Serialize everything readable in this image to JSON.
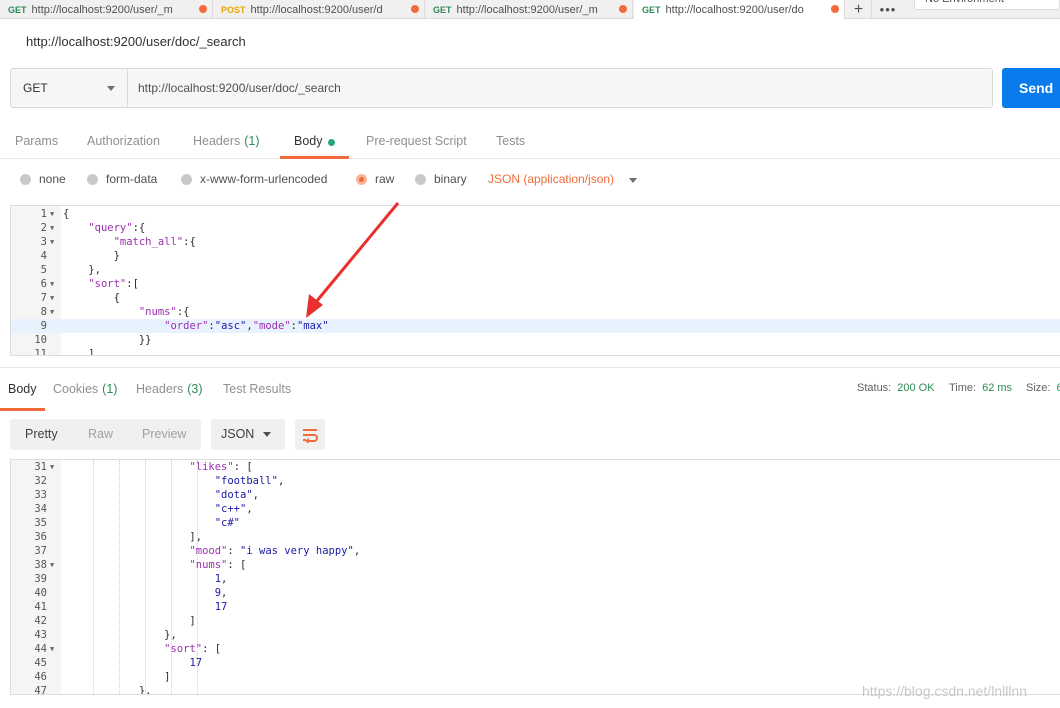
{
  "tabs": [
    {
      "method": "GET",
      "url": "http://localhost:9200/user/_m"
    },
    {
      "method": "POST",
      "url": "http://localhost:9200/user/d"
    },
    {
      "method": "GET",
      "url": "http://localhost:9200/user/_m"
    },
    {
      "method": "GET",
      "url": "http://localhost:9200/user/do"
    }
  ],
  "tabbar": {
    "add": "+",
    "more": "•••",
    "environment": "No Environment"
  },
  "request": {
    "title": "http://localhost:9200/user/doc/_search",
    "method": "GET",
    "url": "http://localhost:9200/user/doc/_search",
    "send_label": "Send"
  },
  "request_tabs": {
    "params": "Params",
    "authorization": "Authorization",
    "headers": "Headers",
    "headers_count": "(1)",
    "body": "Body",
    "prerequest": "Pre-request Script",
    "tests": "Tests"
  },
  "body_types": {
    "none": "none",
    "form_data": "form-data",
    "urlencoded": "x-www-form-urlencoded",
    "raw": "raw",
    "binary": "binary",
    "selected": "raw",
    "content_type": "JSON (application/json)"
  },
  "request_body": [
    {
      "n": "1",
      "fold": true,
      "text": "{"
    },
    {
      "n": "2",
      "fold": true,
      "text": "    \"query\":{"
    },
    {
      "n": "3",
      "fold": true,
      "text": "        \"match_all\":{"
    },
    {
      "n": "4",
      "fold": false,
      "text": "        }"
    },
    {
      "n": "5",
      "fold": false,
      "text": "    },"
    },
    {
      "n": "6",
      "fold": true,
      "text": "    \"sort\":["
    },
    {
      "n": "7",
      "fold": true,
      "text": "        {"
    },
    {
      "n": "8",
      "fold": true,
      "text": "            \"nums\":{"
    },
    {
      "n": "9",
      "fold": false,
      "text": "                \"order\":\"asc\",\"mode\":\"max\""
    },
    {
      "n": "10",
      "fold": false,
      "text": "            }}"
    },
    {
      "n": "11",
      "fold": false,
      "text": "    ]"
    }
  ],
  "response_tabs": {
    "body": "Body",
    "cookies": "Cookies",
    "cookies_count": "(1)",
    "headers": "Headers",
    "headers_count": "(3)",
    "test_results": "Test Results"
  },
  "response_status": {
    "status_label": "Status:",
    "status_value": "200 OK",
    "time_label": "Time:",
    "time_value": "62 ms",
    "size_label": "Size:",
    "size_value": "6"
  },
  "response_format": {
    "pretty": "Pretty",
    "raw": "Raw",
    "preview": "Preview",
    "language": "JSON"
  },
  "response_body": [
    {
      "n": "31",
      "fold": true,
      "text": "                    \"likes\": ["
    },
    {
      "n": "32",
      "fold": false,
      "text": "                        \"football\","
    },
    {
      "n": "33",
      "fold": false,
      "text": "                        \"dota\","
    },
    {
      "n": "34",
      "fold": false,
      "text": "                        \"c++\","
    },
    {
      "n": "35",
      "fold": false,
      "text": "                        \"c#\""
    },
    {
      "n": "36",
      "fold": false,
      "text": "                    ],"
    },
    {
      "n": "37",
      "fold": false,
      "text": "                    \"mood\": \"i was very happy\","
    },
    {
      "n": "38",
      "fold": true,
      "text": "                    \"nums\": ["
    },
    {
      "n": "39",
      "fold": false,
      "text": "                        1,"
    },
    {
      "n": "40",
      "fold": false,
      "text": "                        9,"
    },
    {
      "n": "41",
      "fold": false,
      "text": "                        17"
    },
    {
      "n": "42",
      "fold": false,
      "text": "                    ]"
    },
    {
      "n": "43",
      "fold": false,
      "text": "                },"
    },
    {
      "n": "44",
      "fold": true,
      "text": "                \"sort\": ["
    },
    {
      "n": "45",
      "fold": false,
      "text": "                    17"
    },
    {
      "n": "46",
      "fold": false,
      "text": "                ]"
    },
    {
      "n": "47",
      "fold": false,
      "text": "            },"
    }
  ],
  "watermark": "https://blog.csdn.net/lnlllnn",
  "colors": {
    "accent": "#f26b3a",
    "send": "#097bed",
    "success": "#2e8b57",
    "json_key": "#9b2fae",
    "json_value": "#1a1aa6"
  }
}
